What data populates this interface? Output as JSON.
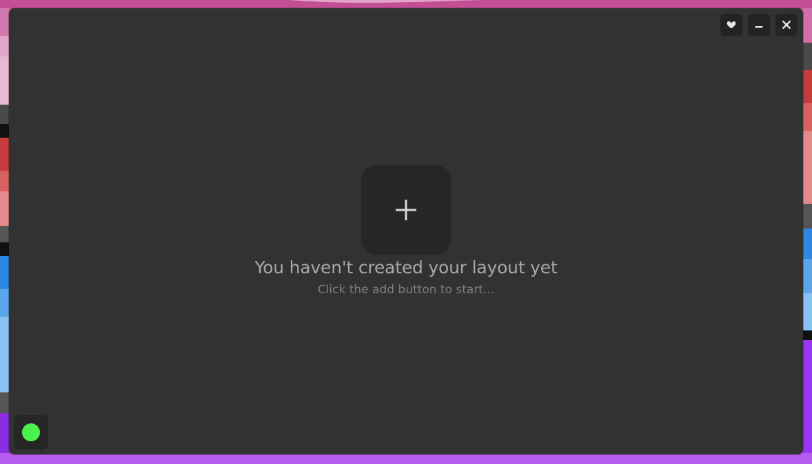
{
  "window": {
    "background": "#323232",
    "controls": [
      {
        "name": "favorite",
        "icon": "heart-icon"
      },
      {
        "name": "minimize",
        "icon": "minimize-icon"
      },
      {
        "name": "close",
        "icon": "close-icon"
      }
    ]
  },
  "empty_state": {
    "add_icon": "plus-icon",
    "title": "You haven't created your layout yet",
    "subtitle": "Click the add button to start..."
  },
  "status": {
    "icon": "status-dot-icon",
    "color": "#4cf24c"
  },
  "colors": {
    "icon_light": "#e6e6e6",
    "title_text": "#a8a8a8",
    "subtitle_text": "#7d7d7d",
    "button_bg": "#262626"
  }
}
